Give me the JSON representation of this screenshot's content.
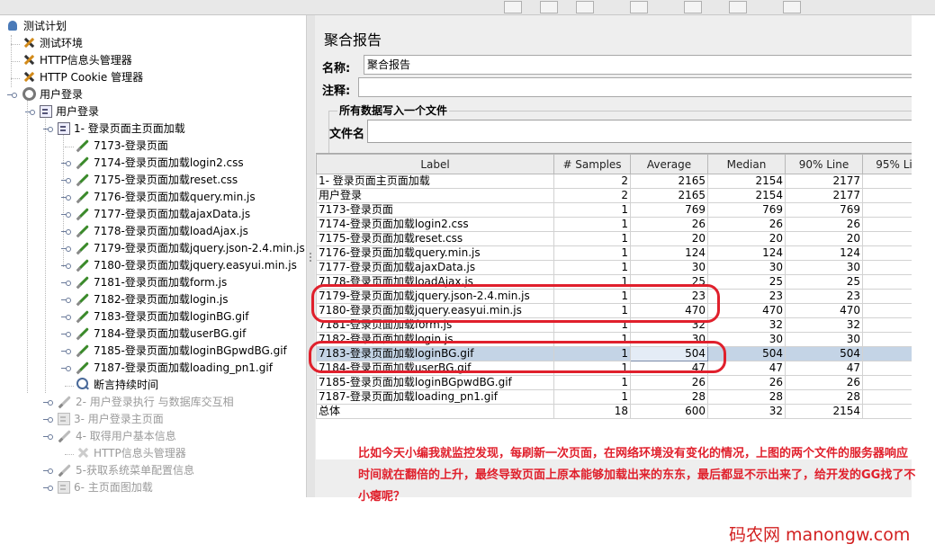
{
  "tree": {
    "nodes": [
      {
        "label": "测试计划",
        "icon": "flask-icon",
        "dim": false
      },
      {
        "label": "测试环境",
        "icon": "wrench-icon",
        "dim": false
      },
      {
        "label": "HTTP信息头管理器",
        "icon": "wrench-icon",
        "dim": false
      },
      {
        "label": "HTTP Cookie 管理器",
        "icon": "wrench-icon",
        "dim": false
      },
      {
        "label": "用户登录",
        "icon": "gear-icon",
        "dim": false
      },
      {
        "label": "用户登录",
        "icon": "controller-icon",
        "dim": false
      },
      {
        "label": "1- 登录页面主页面加载",
        "icon": "controller-icon",
        "dim": false
      },
      {
        "label": "7173-登录页面",
        "icon": "sampler-icon",
        "dim": false
      },
      {
        "label": "7174-登录页面加载login2.css",
        "icon": "sampler-icon",
        "dim": false
      },
      {
        "label": "7175-登录页面加载reset.css",
        "icon": "sampler-icon",
        "dim": false
      },
      {
        "label": "7176-登录页面加载query.min.js",
        "icon": "sampler-icon",
        "dim": false
      },
      {
        "label": "7177-登录页面加载ajaxData.js",
        "icon": "sampler-icon",
        "dim": false
      },
      {
        "label": "7178-登录页面加载loadAjax.js",
        "icon": "sampler-icon",
        "dim": false
      },
      {
        "label": "7179-登录页面加载jquery.json-2.4.min.js",
        "icon": "sampler-icon",
        "dim": false
      },
      {
        "label": "7180-登录页面加载jquery.easyui.min.js",
        "icon": "sampler-icon",
        "dim": false
      },
      {
        "label": "7181-登录页面加载form.js",
        "icon": "sampler-icon",
        "dim": false
      },
      {
        "label": "7182-登录页面加载login.js",
        "icon": "sampler-icon",
        "dim": false
      },
      {
        "label": "7183-登录页面加载loginBG.gif",
        "icon": "sampler-icon",
        "dim": false
      },
      {
        "label": "7184-登录页面加载userBG.gif",
        "icon": "sampler-icon",
        "dim": false
      },
      {
        "label": "7185-登录页面加载loginBGpwdBG.gif",
        "icon": "sampler-icon",
        "dim": false
      },
      {
        "label": "7187-登录页面加载loading_pn1.gif",
        "icon": "sampler-icon",
        "dim": false
      },
      {
        "label": "断言持续时间",
        "icon": "magnifier-icon",
        "dim": false
      },
      {
        "label": "2- 用户登录执行 与数据库交互相",
        "icon": "sampler-icon",
        "dim": true
      },
      {
        "label": "3- 用户登录主页面",
        "icon": "controller-icon",
        "dim": true
      },
      {
        "label": "4- 取得用户基本信息",
        "icon": "sampler-icon",
        "dim": true
      },
      {
        "label": "HTTP信息头管理器",
        "icon": "wrench-icon",
        "dim": true
      },
      {
        "label": "5-获取系统菜单配置信息",
        "icon": "sampler-icon",
        "dim": true
      },
      {
        "label": "6- 主页面图加载",
        "icon": "controller-icon",
        "dim": true
      }
    ]
  },
  "panel": {
    "title": "聚合报告",
    "name_label": "名称:",
    "name_value": "聚合报告",
    "comment_label": "注释:",
    "comment_value": "",
    "group_legend": "所有数据写入一个文件",
    "filename_label": "文件名",
    "filename_value": ""
  },
  "table": {
    "headers": [
      "Label",
      "# Samples",
      "Average",
      "Median",
      "90% Line",
      "95% Li"
    ],
    "rows": [
      {
        "label": "1- 登录页面主页面加载",
        "samples": "2",
        "average": "2165",
        "median": "2154",
        "line90": "2177",
        "line95": ""
      },
      {
        "label": "用户登录",
        "samples": "2",
        "average": "2165",
        "median": "2154",
        "line90": "2177",
        "line95": ""
      },
      {
        "label": "7173-登录页面",
        "samples": "1",
        "average": "769",
        "median": "769",
        "line90": "769",
        "line95": ""
      },
      {
        "label": "7174-登录页面加载login2.css",
        "samples": "1",
        "average": "26",
        "median": "26",
        "line90": "26",
        "line95": ""
      },
      {
        "label": "7175-登录页面加载reset.css",
        "samples": "1",
        "average": "20",
        "median": "20",
        "line90": "20",
        "line95": ""
      },
      {
        "label": "7176-登录页面加载query.min.js",
        "samples": "1",
        "average": "124",
        "median": "124",
        "line90": "124",
        "line95": ""
      },
      {
        "label": "7177-登录页面加载ajaxData.js",
        "samples": "1",
        "average": "30",
        "median": "30",
        "line90": "30",
        "line95": ""
      },
      {
        "label": "7178-登录页面加载loadAjax.js",
        "samples": "1",
        "average": "25",
        "median": "25",
        "line90": "25",
        "line95": ""
      },
      {
        "label": "7179-登录页面加载jquery.json-2.4.min.js",
        "samples": "1",
        "average": "23",
        "median": "23",
        "line90": "23",
        "line95": ""
      },
      {
        "label": "7180-登录页面加载jquery.easyui.min.js",
        "samples": "1",
        "average": "470",
        "median": "470",
        "line90": "470",
        "line95": ""
      },
      {
        "label": "7181-登录页面加载form.js",
        "samples": "1",
        "average": "32",
        "median": "32",
        "line90": "32",
        "line95": ""
      },
      {
        "label": "7182-登录页面加载login.js",
        "samples": "1",
        "average": "30",
        "median": "30",
        "line90": "30",
        "line95": ""
      },
      {
        "label": "7183-登录页面加载loginBG.gif",
        "samples": "1",
        "average": "504",
        "median": "504",
        "line90": "504",
        "line95": "",
        "selected": true
      },
      {
        "label": "7184-登录页面加载userBG.gif",
        "samples": "1",
        "average": "47",
        "median": "47",
        "line90": "47",
        "line95": ""
      },
      {
        "label": "7185-登录页面加载loginBGpwdBG.gif",
        "samples": "1",
        "average": "26",
        "median": "26",
        "line90": "26",
        "line95": ""
      },
      {
        "label": "7187-登录页面加载loading_pn1.gif",
        "samples": "1",
        "average": "28",
        "median": "28",
        "line90": "28",
        "line95": ""
      },
      {
        "label": "总体",
        "samples": "18",
        "average": "600",
        "median": "32",
        "line90": "2154",
        "line95": ""
      }
    ]
  },
  "annotation": "比如今天小编我就监控发现，每刷新一次页面，在网络环境没有变化的情况，上图的两个文件的服务器响应时间就在翻倍的上升，最终导致页面上原本能够加载出来的东东，最后都显不示出来了，给开发的GG找了不小瘪呢？",
  "watermark": "码农网 manongw.com",
  "colors": {
    "annotation": "#e0202c",
    "selected_row": "#c4d4e6",
    "panel_bg": "#eeeeee"
  }
}
